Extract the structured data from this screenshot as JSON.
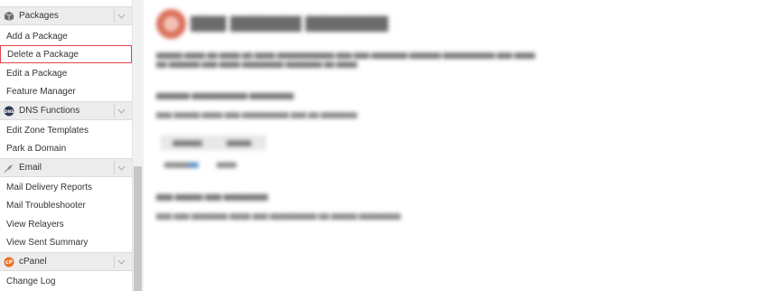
{
  "sidebar": {
    "packages": {
      "header": "Packages",
      "items": [
        "Add a Package",
        "Delete a Package",
        "Edit a Package",
        "Feature Manager"
      ],
      "selected_index": 1
    },
    "dns": {
      "header": "DNS Functions",
      "items": [
        "Edit Zone Templates",
        "Park a Domain"
      ]
    },
    "email": {
      "header": "Email",
      "items": [
        "Mail Delivery Reports",
        "Mail Troubleshooter",
        "View Relayers",
        "View Sent Summary"
      ]
    },
    "cpanel": {
      "header": "cPanel",
      "items": [
        "Change Log"
      ]
    }
  },
  "colors": {
    "selected_border": "#e0454b",
    "header_bg": "#ececec",
    "cpanel_orange": "#e8702a"
  },
  "icons": {
    "packages": "package-icon",
    "dns": "dns-icon",
    "email": "email-icon",
    "cpanel": "cpanel-icon",
    "collapse": "chevron-down-icon"
  }
}
